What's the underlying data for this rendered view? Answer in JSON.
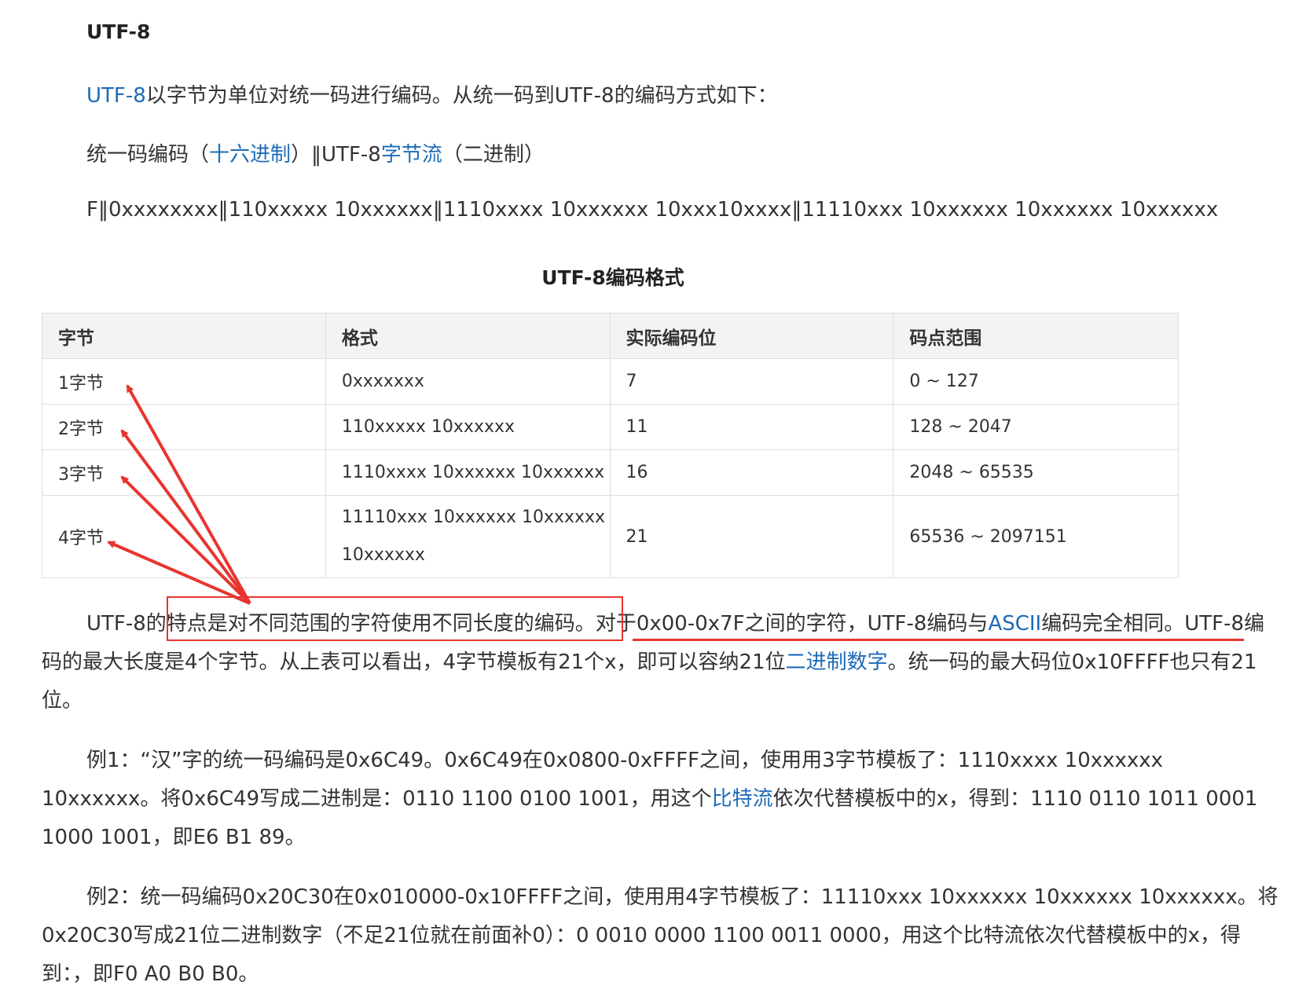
{
  "heading": "UTF-8",
  "intro": {
    "link": "UTF-8",
    "text": "以字节为单位对统一码进行编码。从统一码到UTF-8的编码方式如下："
  },
  "legend_line": {
    "pre": "统一码编码（",
    "link1": "十六进制",
    "mid": "）‖UTF-8",
    "link2": "字节流",
    "post": "（二进制）"
  },
  "format_line": "F‖0xxxxxxxx‖110xxxxx 10xxxxxx‖1110xxxx 10xxxxxx 10xxx10xxxx‖11110xxx 10xxxxxx 10xxxxxx 10xxxxxx",
  "table": {
    "caption": "UTF-8编码格式",
    "headers": [
      "字节",
      "格式",
      "实际编码位",
      "码点范围"
    ],
    "rows": [
      [
        "1字节",
        "0xxxxxxx",
        "7",
        "0 ~ 127"
      ],
      [
        "2字节",
        "110xxxxx 10xxxxxx",
        "11",
        "128 ~ 2047"
      ],
      [
        "3字节",
        "1110xxxx 10xxxxxx 10xxxxxx",
        "16",
        "2048 ~ 65535"
      ],
      [
        "4字节",
        "11110xxx 10xxxxxx 10xxxxxx 10xxxxxx",
        "21",
        "65536 ~ 2097151"
      ]
    ]
  },
  "para1": {
    "pre": "UTF-8的",
    "boxed": "特点是对不同范围的字符使用不同长度的编码。",
    "underlined_pre": "对于0x00-0x7F之间的字符，UTF-8编码与",
    "link": "ASCII",
    "underlined_post": "编码完全相同。",
    "rest_pre": "UTF-8编码的最大长度是4个字节。从上表可以看出，4字节模板有21个x，即可以容纳21位",
    "link2": "二进制数字",
    "rest_post": "。统一码的最大码位0x10FFFF也只有21位。"
  },
  "para2": {
    "pre": "例1：“汉”字的统一码编码是0x6C49。0x6C49在0x0800-0xFFFF之间，使用用3字节模板了：1110xxxx 10xxxxxx 10xxxxxx。将0x6C49写成二进制是：0110 1100 0100 1001，用这个",
    "link": "比特流",
    "post": "依次代替模板中的x，得到：1110 0110 1011 0001 1000 1001，即E6 B1 89。"
  },
  "para3": {
    "text": "例2：统一码编码0x20C30在0x010000-0x10FFFF之间，使用用4字节模板了：11110xxx 10xxxxxx 10xxxxxx 10xxxxxx。将0x20C30写成21位二进制数字（不足21位就在前面补0）：0 0010 0000 1100 0011 0000，用这个比特流依次代替模板中的x，得到：，即F0 A0 B0 B0。"
  },
  "colors": {
    "link": "#1e6bb8",
    "annotation": "#e8352f",
    "text": "#333333"
  }
}
